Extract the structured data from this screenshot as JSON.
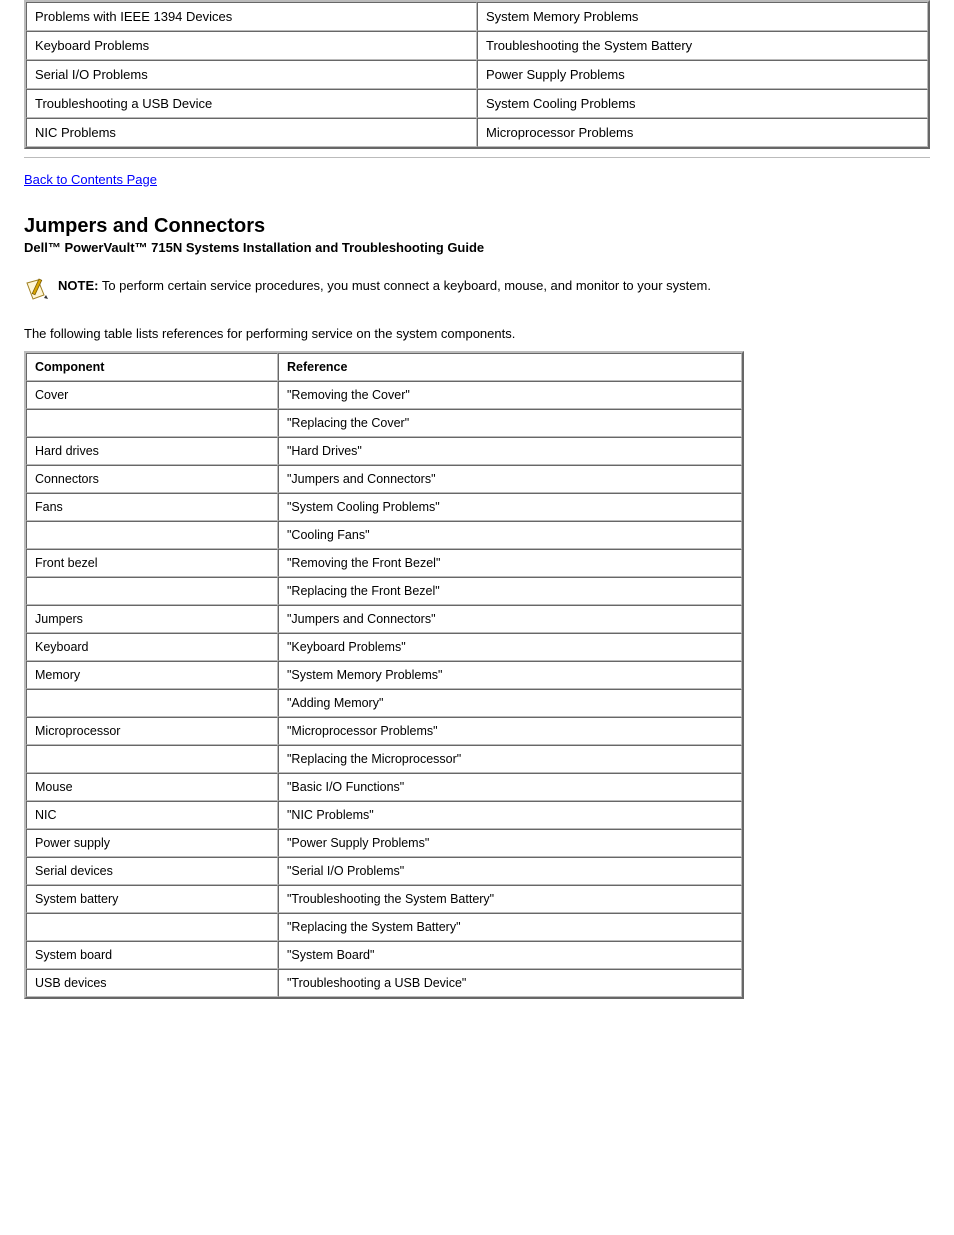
{
  "top_table": {
    "rows": [
      {
        "left": "Problems with IEEE 1394 Devices",
        "right": "System Memory Problems"
      },
      {
        "left": "Keyboard Problems",
        "right": "Troubleshooting the System Battery"
      },
      {
        "left": "Serial I/O Problems",
        "right": "Power Supply Problems"
      },
      {
        "left": "Troubleshooting a USB Device",
        "right": "System Cooling Problems"
      },
      {
        "left": "NIC Problems",
        "right": "Microprocessor Problems"
      }
    ]
  },
  "back_to_contents": "Back to Contents Page",
  "section_heading": "Jumpers and Connectors",
  "manual_title": "Dell™ PowerVault™ 715N Systems Installation and Troubleshooting Guide",
  "note": {
    "prefix": "NOTE:",
    "body": "To perform certain service procedures, you must connect a keyboard, mouse, and monitor to your system.",
    "icon_name": "note-icon"
  },
  "table_intro": "The following table lists references for performing service on the system components.",
  "ref_table": {
    "headers": {
      "component": "Component",
      "reference": "Reference"
    },
    "rows": [
      {
        "component": "Cover",
        "reference": "\"Removing the Cover\""
      },
      {
        "component": "",
        "reference": "\"Replacing the Cover\""
      },
      {
        "component": "Hard drives",
        "reference": "\"Hard Drives\""
      },
      {
        "component": "Connectors",
        "reference": "\"Jumpers and Connectors\""
      },
      {
        "component": "Fans",
        "reference": "\"System Cooling Problems\""
      },
      {
        "component": "",
        "reference": "\"Cooling Fans\""
      },
      {
        "component": "Front bezel",
        "reference": "\"Removing the Front Bezel\""
      },
      {
        "component": "",
        "reference": "\"Replacing the Front Bezel\""
      },
      {
        "component": "Jumpers",
        "reference": "\"Jumpers and Connectors\""
      },
      {
        "component": "Keyboard",
        "reference": "\"Keyboard Problems\""
      },
      {
        "component": "Memory",
        "reference": "\"System Memory Problems\""
      },
      {
        "component": "",
        "reference": "\"Adding Memory\""
      },
      {
        "component": "Microprocessor",
        "reference": "\"Microprocessor Problems\""
      },
      {
        "component": "",
        "reference": "\"Replacing the Microprocessor\""
      },
      {
        "component": "Mouse",
        "reference": "\"Basic I/O Functions\""
      },
      {
        "component": "NIC",
        "reference": "\"NIC Problems\""
      },
      {
        "component": "Power supply",
        "reference": "\"Power Supply Problems\""
      },
      {
        "component": "Serial devices",
        "reference": "\"Serial I/O Problems\""
      },
      {
        "component": "System battery",
        "reference": "\"Troubleshooting the System Battery\""
      },
      {
        "component": "",
        "reference": "\"Replacing the System Battery\""
      },
      {
        "component": "System board",
        "reference": "\"System Board\""
      },
      {
        "component": "USB devices",
        "reference": "\"Troubleshooting a USB Device\""
      }
    ]
  }
}
